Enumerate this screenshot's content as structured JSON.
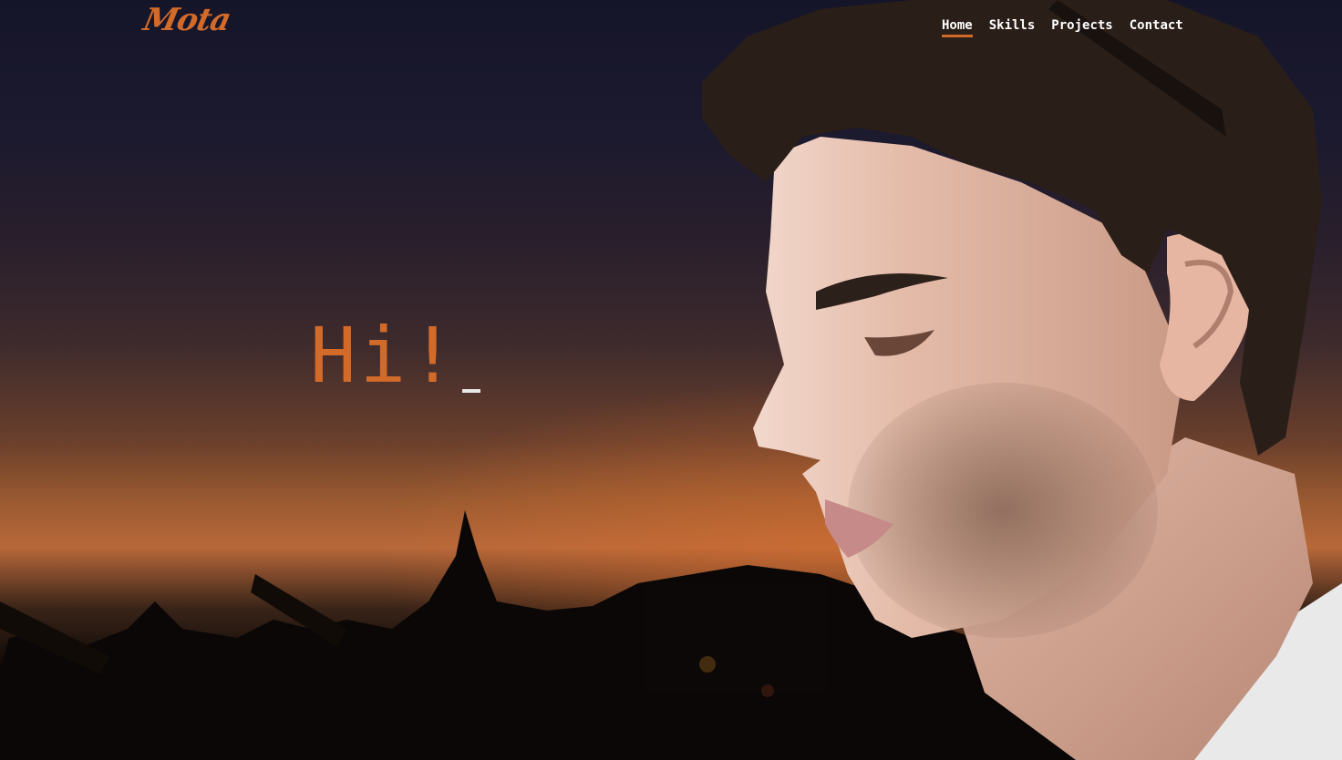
{
  "brand": {
    "logo_text": "Mota",
    "accent_color": "#d26a2a"
  },
  "nav": {
    "items": [
      {
        "label": "Home",
        "active": true
      },
      {
        "label": "Skills",
        "active": false
      },
      {
        "label": "Projects",
        "active": false
      },
      {
        "label": "Contact",
        "active": false
      }
    ]
  },
  "hero": {
    "greeting": "Hi!",
    "cursor_glyph": "_",
    "background_image": "portrait-of-young-man-at-dusk"
  }
}
